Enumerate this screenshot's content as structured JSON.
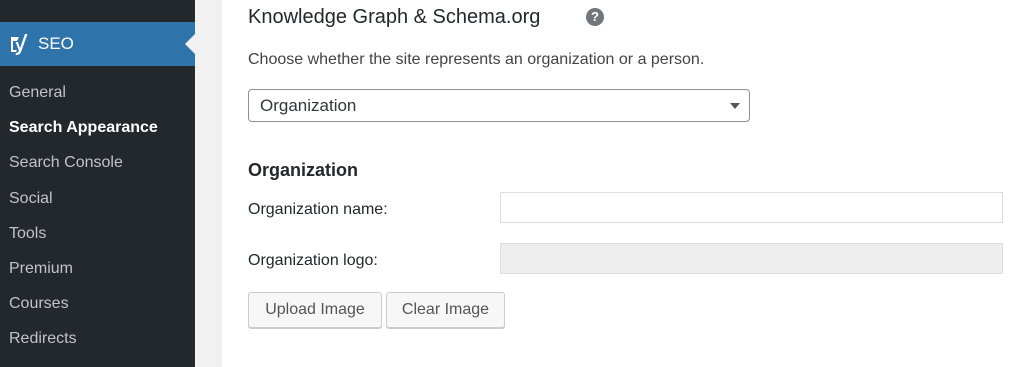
{
  "sidebar": {
    "menu_title": "SEO",
    "icon": "yoast-logo-icon",
    "items": [
      {
        "label": "General",
        "current": false
      },
      {
        "label": "Search Appearance",
        "current": true
      },
      {
        "label": "Search Console",
        "current": false
      },
      {
        "label": "Social",
        "current": false
      },
      {
        "label": "Tools",
        "current": false
      },
      {
        "label": "Premium",
        "current": false
      },
      {
        "label": "Courses",
        "current": false
      },
      {
        "label": "Redirects",
        "current": false
      }
    ],
    "colors": {
      "background": "#23282d",
      "active": "#2e73aa"
    }
  },
  "section": {
    "heading": "Knowledge Graph & Schema.org",
    "help_icon": "question-mark-icon",
    "help_glyph": "?",
    "description": "Choose whether the site represents an organization or a person.",
    "select": {
      "value": "Organization"
    }
  },
  "organization": {
    "heading": "Organization",
    "name_label": "Organization name:",
    "name_value": "",
    "logo_label": "Organization logo:",
    "logo_value": "",
    "upload_button": "Upload Image",
    "clear_button": "Clear Image"
  }
}
